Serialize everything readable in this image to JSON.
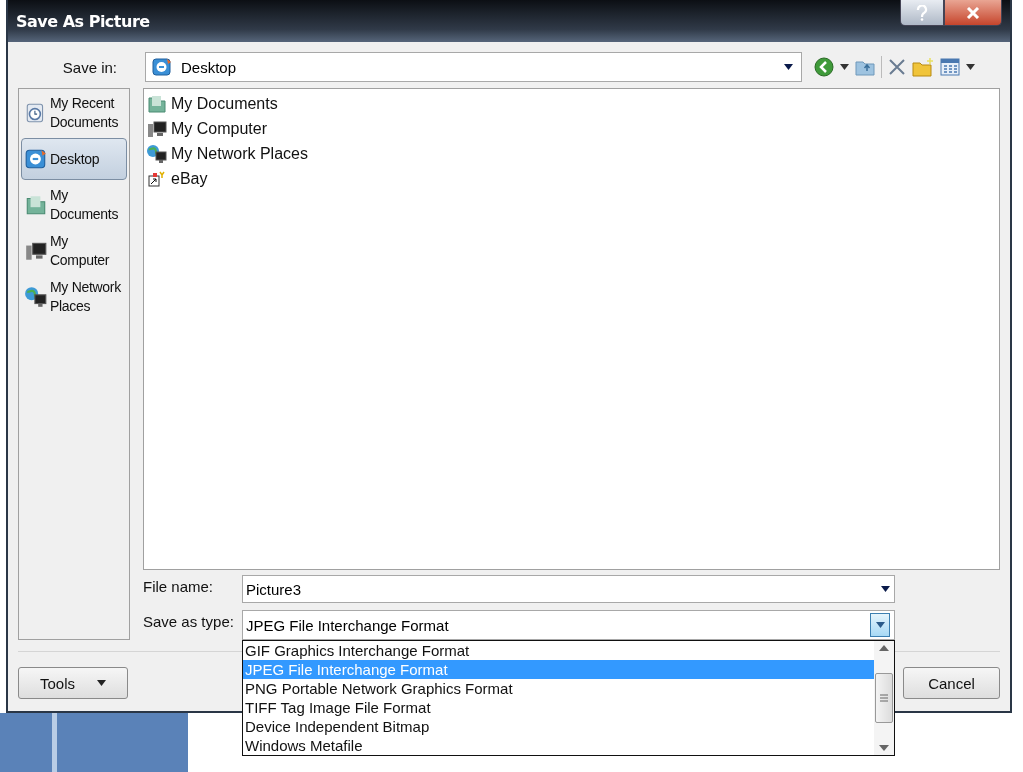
{
  "window": {
    "title": "Save As Picture"
  },
  "save_in": {
    "label": "Save in:",
    "value": "Desktop"
  },
  "places": [
    {
      "label": "My Recent Documents",
      "kind": "recent",
      "selected": false
    },
    {
      "label": "Desktop",
      "kind": "desktop",
      "selected": true
    },
    {
      "label": "My Documents",
      "kind": "documents",
      "selected": false
    },
    {
      "label": "My Computer",
      "kind": "computer",
      "selected": false
    },
    {
      "label": "My Network Places",
      "kind": "network",
      "selected": false
    }
  ],
  "files": [
    {
      "name": "My Documents",
      "kind": "documents"
    },
    {
      "name": "My Computer",
      "kind": "computer"
    },
    {
      "name": "My Network Places",
      "kind": "network"
    },
    {
      "name": "eBay",
      "kind": "shortcut"
    }
  ],
  "file_name": {
    "label": "File name:",
    "value": "Picture3"
  },
  "save_as_type": {
    "label": "Save as type:",
    "value": "JPEG File Interchange Format",
    "expanded": true
  },
  "type_options": [
    {
      "label": "GIF Graphics Interchange Format",
      "selected": false
    },
    {
      "label": "JPEG File Interchange Format",
      "selected": true
    },
    {
      "label": "PNG Portable Network Graphics Format",
      "selected": false
    },
    {
      "label": "TIFF Tag Image File Format",
      "selected": false
    },
    {
      "label": "Device Independent Bitmap",
      "selected": false
    },
    {
      "label": "Windows Metafile",
      "selected": false
    }
  ],
  "buttons": [
    {
      "label": "Tools",
      "kind": "menu"
    },
    {
      "label": "Cancel",
      "kind": "plain"
    }
  ]
}
